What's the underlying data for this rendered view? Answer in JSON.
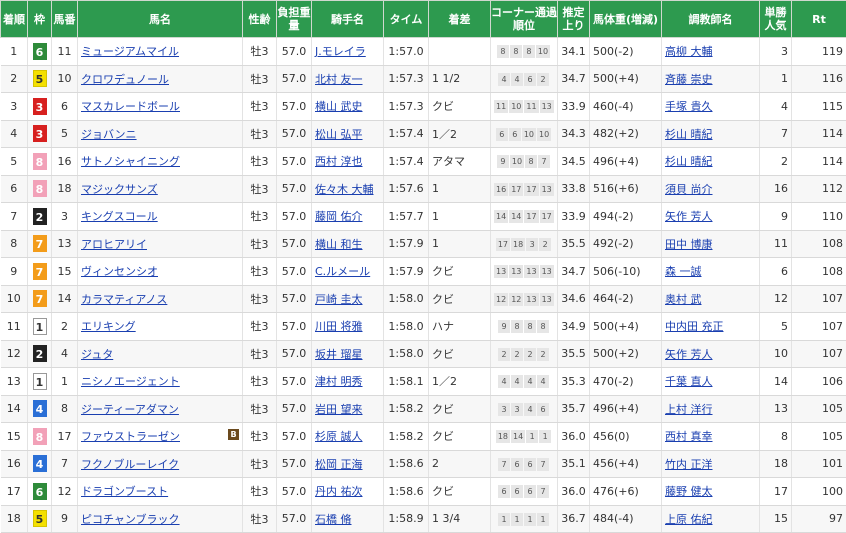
{
  "headers": [
    "着順",
    "枠",
    "馬番",
    "馬名",
    "性齢",
    "負担重量",
    "騎手名",
    "タイム",
    "着差",
    "コーナー通過順位",
    "推定上り",
    "馬体重(増減)",
    "調教師名",
    "単勝人気",
    "Rt"
  ],
  "waku_colors": {
    "1": {
      "bg": "#ffffff",
      "fg": "#333333",
      "border": "#999999"
    },
    "2": {
      "bg": "#222222",
      "fg": "#ffffff",
      "border": "#222222"
    },
    "3": {
      "bg": "#d7201f",
      "fg": "#ffffff",
      "border": "#d7201f"
    },
    "4": {
      "bg": "#2a6fd6",
      "fg": "#ffffff",
      "border": "#2a6fd6"
    },
    "5": {
      "bg": "#f4e000",
      "fg": "#333333",
      "border": "#d6c400"
    },
    "6": {
      "bg": "#2e8b3a",
      "fg": "#ffffff",
      "border": "#2e8b3a"
    },
    "7": {
      "bg": "#f39c1a",
      "fg": "#ffffff",
      "border": "#f39c1a"
    },
    "8": {
      "bg": "#f2a1b8",
      "fg": "#ffffff",
      "border": "#f2a1b8"
    }
  },
  "rows": [
    {
      "rank": "1",
      "waku": "6",
      "num": "11",
      "name": "ミュージアムマイル",
      "sex": "牡3",
      "weight": "57.0",
      "jockey": "J.モレイラ",
      "time": "1:57.0",
      "margin": "",
      "corner": [
        "8",
        "8",
        "8",
        "10"
      ],
      "agari": "34.1",
      "body": "500",
      "diff": "(-2)",
      "trainer": "高柳 大輔",
      "pop": "3",
      "rt": "119"
    },
    {
      "rank": "2",
      "waku": "5",
      "num": "10",
      "name": "クロワデュノール",
      "sex": "牡3",
      "weight": "57.0",
      "jockey": "北村 友一",
      "time": "1:57.3",
      "margin": "1 1/2",
      "corner": [
        "4",
        "4",
        "6",
        "2"
      ],
      "agari": "34.7",
      "body": "500",
      "diff": "(+4)",
      "trainer": "斉藤 崇史",
      "pop": "1",
      "rt": "116"
    },
    {
      "rank": "3",
      "waku": "3",
      "num": "6",
      "name": "マスカレードボール",
      "sex": "牡3",
      "weight": "57.0",
      "jockey": "横山 武史",
      "time": "1:57.3",
      "margin": "クビ",
      "corner": [
        "11",
        "10",
        "11",
        "13"
      ],
      "agari": "33.9",
      "body": "460",
      "diff": "(-4)",
      "trainer": "手塚 貴久",
      "pop": "4",
      "rt": "115"
    },
    {
      "rank": "4",
      "waku": "3",
      "num": "5",
      "name": "ジョバンニ",
      "sex": "牡3",
      "weight": "57.0",
      "jockey": "松山 弘平",
      "time": "1:57.4",
      "margin": "1／2",
      "corner": [
        "6",
        "6",
        "10",
        "10"
      ],
      "agari": "34.3",
      "body": "482",
      "diff": "(+2)",
      "trainer": "杉山 晴紀",
      "pop": "7",
      "rt": "114"
    },
    {
      "rank": "5",
      "waku": "8",
      "num": "16",
      "name": "サトノシャイニング",
      "sex": "牡3",
      "weight": "57.0",
      "jockey": "西村 淳也",
      "time": "1:57.4",
      "margin": "アタマ",
      "corner": [
        "9",
        "10",
        "8",
        "7"
      ],
      "agari": "34.5",
      "body": "496",
      "diff": "(+4)",
      "trainer": "杉山 晴紀",
      "pop": "2",
      "rt": "114"
    },
    {
      "rank": "6",
      "waku": "8",
      "num": "18",
      "name": "マジックサンズ",
      "sex": "牡3",
      "weight": "57.0",
      "jockey": "佐々木 大輔",
      "time": "1:57.6",
      "margin": "1",
      "corner": [
        "16",
        "17",
        "17",
        "13"
      ],
      "agari": "33.8",
      "body": "516",
      "diff": "(+6)",
      "trainer": "須貝 尚介",
      "pop": "16",
      "rt": "112"
    },
    {
      "rank": "7",
      "waku": "2",
      "num": "3",
      "name": "キングスコール",
      "sex": "牡3",
      "weight": "57.0",
      "jockey": "藤岡 佑介",
      "time": "1:57.7",
      "margin": "1",
      "corner": [
        "14",
        "14",
        "17",
        "17"
      ],
      "agari": "33.9",
      "body": "494",
      "diff": "(-2)",
      "trainer": "矢作 芳人",
      "pop": "9",
      "rt": "110"
    },
    {
      "rank": "8",
      "waku": "7",
      "num": "13",
      "name": "アロヒアリイ",
      "sex": "牡3",
      "weight": "57.0",
      "jockey": "横山 和生",
      "time": "1:57.9",
      "margin": "1",
      "corner": [
        "17",
        "18",
        "3",
        "2"
      ],
      "agari": "35.5",
      "body": "492",
      "diff": "(-2)",
      "trainer": "田中 博康",
      "pop": "11",
      "rt": "108"
    },
    {
      "rank": "9",
      "waku": "7",
      "num": "15",
      "name": "ヴィンセンシオ",
      "sex": "牡3",
      "weight": "57.0",
      "jockey": "C.ルメール",
      "time": "1:57.9",
      "margin": "クビ",
      "corner": [
        "13",
        "13",
        "13",
        "13"
      ],
      "agari": "34.7",
      "body": "506",
      "diff": "(-10)",
      "trainer": "森 一誠",
      "pop": "6",
      "rt": "108"
    },
    {
      "rank": "10",
      "waku": "7",
      "num": "14",
      "name": "カラマティアノス",
      "sex": "牡3",
      "weight": "57.0",
      "jockey": "戸崎 圭太",
      "time": "1:58.0",
      "margin": "クビ",
      "corner": [
        "12",
        "12",
        "13",
        "13"
      ],
      "agari": "34.6",
      "body": "464",
      "diff": "(-2)",
      "trainer": "奥村 武",
      "pop": "12",
      "rt": "107"
    },
    {
      "rank": "11",
      "waku": "1",
      "num": "2",
      "name": "エリキング",
      "sex": "牡3",
      "weight": "57.0",
      "jockey": "川田 将雅",
      "time": "1:58.0",
      "margin": "ハナ",
      "corner": [
        "9",
        "8",
        "8",
        "8"
      ],
      "agari": "34.9",
      "body": "500",
      "diff": "(+4)",
      "trainer": "中内田 充正",
      "pop": "5",
      "rt": "107"
    },
    {
      "rank": "12",
      "waku": "2",
      "num": "4",
      "name": "ジュタ",
      "sex": "牡3",
      "weight": "57.0",
      "jockey": "坂井 瑠星",
      "time": "1:58.0",
      "margin": "クビ",
      "corner": [
        "2",
        "2",
        "2",
        "2"
      ],
      "agari": "35.5",
      "body": "500",
      "diff": "(+2)",
      "trainer": "矢作 芳人",
      "pop": "10",
      "rt": "107"
    },
    {
      "rank": "13",
      "waku": "1",
      "num": "1",
      "name": "ニシノエージェント",
      "sex": "牡3",
      "weight": "57.0",
      "jockey": "津村 明秀",
      "time": "1:58.1",
      "margin": "1／2",
      "corner": [
        "4",
        "4",
        "4",
        "4"
      ],
      "agari": "35.3",
      "body": "470",
      "diff": "(-2)",
      "trainer": "千葉 直人",
      "pop": "14",
      "rt": "106"
    },
    {
      "rank": "14",
      "waku": "4",
      "num": "8",
      "name": "ジーティーアダマン",
      "sex": "牡3",
      "weight": "57.0",
      "jockey": "岩田 望来",
      "time": "1:58.2",
      "margin": "クビ",
      "corner": [
        "3",
        "3",
        "4",
        "6"
      ],
      "agari": "35.7",
      "body": "496",
      "diff": "(+4)",
      "trainer": "上村 洋行",
      "pop": "13",
      "rt": "105"
    },
    {
      "rank": "15",
      "waku": "8",
      "num": "17",
      "name": "ファウストラーゼン",
      "sex": "牡3",
      "weight": "57.0",
      "jockey": "杉原 誠人",
      "time": "1:58.2",
      "margin": "クビ",
      "corner": [
        "18",
        "14",
        "1",
        "1"
      ],
      "agari": "36.0",
      "body": "456",
      "diff": "(0)",
      "trainer": "西村 真幸",
      "pop": "8",
      "rt": "105"
    },
    {
      "rank": "16",
      "waku": "4",
      "num": "7",
      "name": "フクノブルーレイク",
      "sex": "牡3",
      "weight": "57.0",
      "jockey": "松岡 正海",
      "time": "1:58.6",
      "margin": "2",
      "corner": [
        "7",
        "6",
        "6",
        "7"
      ],
      "agari": "35.1",
      "body": "456",
      "diff": "(+4)",
      "trainer": "竹内 正洋",
      "pop": "18",
      "rt": "101"
    },
    {
      "rank": "17",
      "waku": "6",
      "num": "12",
      "name": "ドラゴンブースト",
      "sex": "牡3",
      "weight": "57.0",
      "jockey": "丹内 祐次",
      "time": "1:58.6",
      "margin": "クビ",
      "corner": [
        "6",
        "6",
        "6",
        "7"
      ],
      "agari": "36.0",
      "body": "476",
      "diff": "(+6)",
      "trainer": "藤野 健太",
      "pop": "17",
      "rt": "100"
    },
    {
      "rank": "18",
      "waku": "5",
      "num": "9",
      "name": "ピコチャンブラック",
      "sex": "牡3",
      "weight": "57.0",
      "jockey": "石橋 脩",
      "time": "1:58.9",
      "margin": "1 3/4",
      "corner": [
        "1",
        "1",
        "1",
        "1"
      ],
      "agari": "36.7",
      "body": "484",
      "diff": "(-4)",
      "trainer": "上原 佑紀",
      "pop": "15",
      "rt": "97"
    }
  ],
  "blinker_row": "15",
  "blinker_label": "B"
}
